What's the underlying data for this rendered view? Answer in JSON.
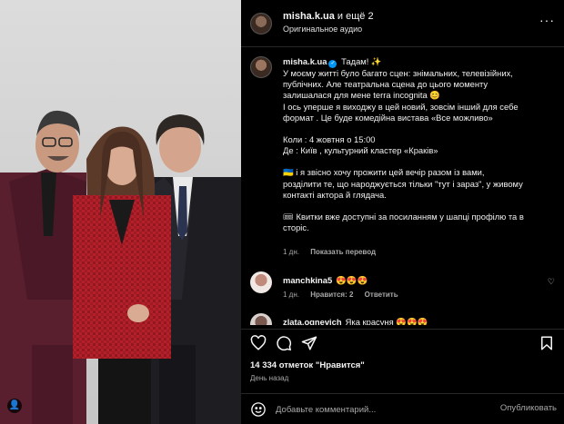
{
  "photo": {
    "alt_icon": "user-tag-icon",
    "tag_glyph": "👤"
  },
  "header": {
    "username": "misha.k.ua",
    "and_more": " и ещё 2",
    "audio": "Оригинальное аудио",
    "more_glyph": "···"
  },
  "caption": {
    "username": "misha.k.ua",
    "verified_glyph": "✓",
    "lines": [
      "Тадам! ✨",
      "У моєму житті було багато сцен: знімальних, телевізійних,",
      "публічних. Але театральна сцена до цього моменту",
      "залишалася для мене terra incognita 😊",
      "І ось уперше я виходжу в цей новий, зовсім інший для себе",
      "формат . Це буде комедійна вистава «Все можливо»",
      "",
      "Коли : 4 жовтня о 15:00",
      "Де : Київ , культурний кластер «Краків»",
      "",
      "🇺🇦 і я звісно хочу прожити цей вечір разом із вами,",
      "розділити те, що народжується тільки \"тут і зараз\", у живому",
      "контакті актора й глядача.",
      "",
      "🎟 Квитки вже доступні за посиланням у шапці профілю та в",
      "сторіс."
    ],
    "time": "1 дн.",
    "translate": "Показать перевод"
  },
  "comments": [
    {
      "username": "manchkina5",
      "text": "😍😍😍",
      "time": "1 дн.",
      "likes": "Нравится: 2",
      "reply": "Ответить",
      "heart": "♡"
    },
    {
      "username": "zlata.ognevich",
      "text": "Яка красуня 😍😍😍",
      "time": "",
      "likes": "",
      "reply": "",
      "heart": ""
    }
  ],
  "likes_text": "14 334 отметок \"Нравится\"",
  "date_text": "День назад",
  "add_comment": {
    "placeholder": "Добавьте комментарий...",
    "publish": "Опубликовать"
  },
  "colors": {
    "background": "#000000",
    "text": "#f5f5f5",
    "muted": "#a8a8a8",
    "verified": "#0095f6",
    "suit_red": "#b3202a",
    "suit_burgundy": "#5a1f2e"
  }
}
